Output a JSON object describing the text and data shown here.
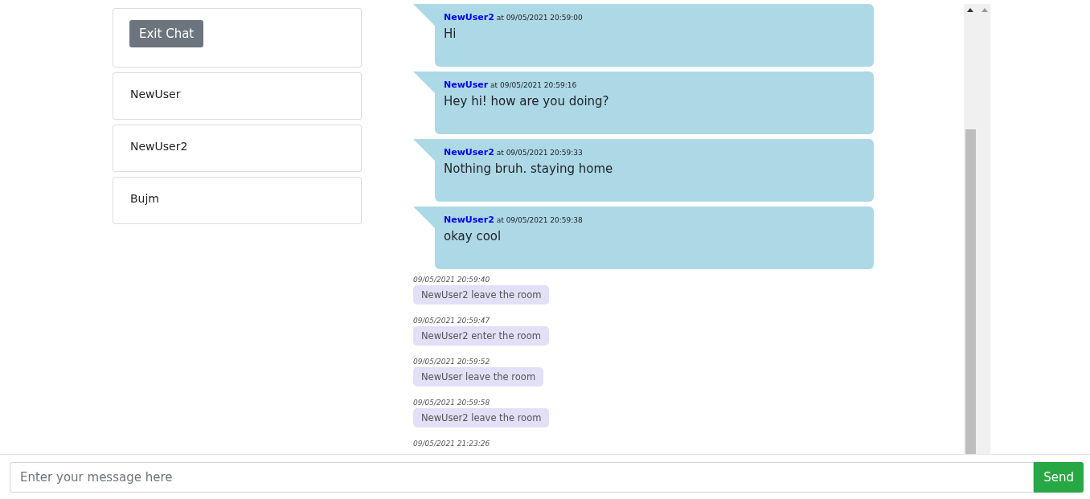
{
  "sidebar": {
    "exit_button": "Exit Chat",
    "users": [
      {
        "name": "NewUser"
      },
      {
        "name": "NewUser2"
      },
      {
        "name": "Bujm"
      }
    ]
  },
  "messages": [
    {
      "kind": "chat",
      "author": "NewUser2",
      "time": "at 09/05/2021 20:59:00",
      "text": "Hi"
    },
    {
      "kind": "chat",
      "author": "NewUser",
      "time": "at 09/05/2021 20:59:16",
      "text": "Hey hi! how are you doing?"
    },
    {
      "kind": "chat",
      "author": "NewUser2",
      "time": "at 09/05/2021 20:59:33",
      "text": "Nothing bruh. staying home"
    },
    {
      "kind": "chat",
      "author": "NewUser2",
      "time": "at 09/05/2021 20:59:38",
      "text": "okay cool"
    },
    {
      "kind": "event",
      "time": "09/05/2021 20:59:40",
      "text": "NewUser2 leave the room"
    },
    {
      "kind": "event",
      "time": "09/05/2021 20:59:47",
      "text": "NewUser2 enter the room"
    },
    {
      "kind": "event",
      "time": "09/05/2021 20:59:52",
      "text": "NewUser leave the room"
    },
    {
      "kind": "event",
      "time": "09/05/2021 20:59:58",
      "text": "NewUser2 leave the room"
    },
    {
      "kind": "event",
      "time": "09/05/2021 21:23:26"
    }
  ],
  "composer": {
    "placeholder": "Enter your message here",
    "send_button": "Send"
  }
}
